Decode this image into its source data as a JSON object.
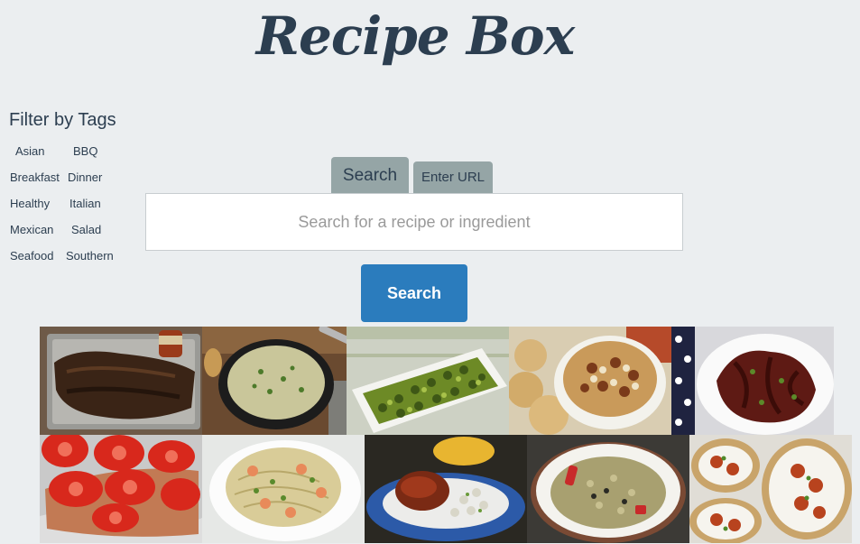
{
  "header": {
    "logo_text": "Recipe Box"
  },
  "filters": {
    "title": "Filter by Tags",
    "tags": [
      "Asian",
      "BBQ",
      "Breakfast",
      "Dinner",
      "Healthy",
      "Italian",
      "Mexican",
      "Salad",
      "Seafood",
      "Southern"
    ]
  },
  "search": {
    "tabs": [
      {
        "label": "Search",
        "active": true
      },
      {
        "label": "Enter URL",
        "active": false
      }
    ],
    "placeholder": "Search for a recipe or ingredient",
    "value": "",
    "button_label": "Search"
  },
  "colors": {
    "background": "#ebeef0",
    "text": "#2c3e50",
    "tab": "#95a5a6",
    "button": "#2b7cbd"
  },
  "recipe_tiles": [
    {
      "icon": "blackened-fish-photo"
    },
    {
      "icon": "soup-skillet-photo"
    },
    {
      "icon": "zucchini-platter-photo"
    },
    {
      "icon": "baked-beans-biscuits-photo"
    },
    {
      "icon": "octopus-stew-photo"
    },
    {
      "icon": "tomato-fish-foil-photo"
    },
    {
      "icon": "shrimp-pasta-photo"
    },
    {
      "icon": "chicken-rice-plate-photo"
    },
    {
      "icon": "quinoa-bowl-photo"
    },
    {
      "icon": "shrimp-tacos-photo"
    }
  ]
}
